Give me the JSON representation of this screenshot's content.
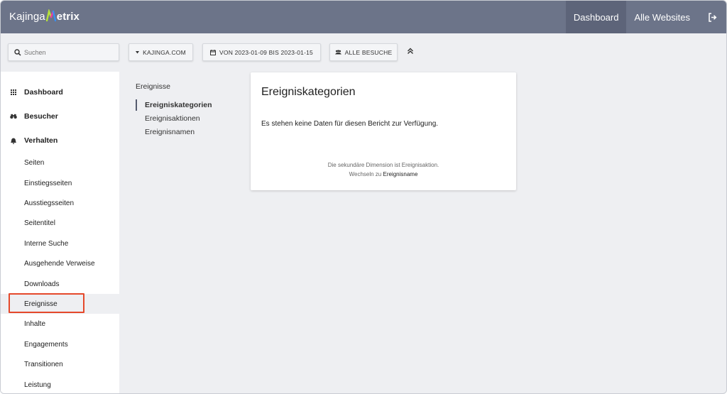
{
  "header": {
    "logo_left": "Kajinga",
    "logo_right": "etrix",
    "nav": [
      {
        "label": "Dashboard",
        "active": true
      },
      {
        "label": "Alle Websites",
        "active": false
      }
    ],
    "logout_icon": "logout-icon"
  },
  "filters": {
    "search_placeholder": "Suchen",
    "site_label": "KAJINGA.COM",
    "date_label": "VON 2023-01-09 BIS 2023-01-15",
    "segment_label": "ALLE BESUCHE",
    "collapse_icon": "double-chevron-up-icon"
  },
  "sidebar": {
    "sections": [
      {
        "label": "Dashboard",
        "icon": "grid-icon"
      },
      {
        "label": "Besucher",
        "icon": "binoculars-icon"
      },
      {
        "label": "Verhalten",
        "icon": "bell-icon"
      }
    ],
    "items": [
      {
        "label": "Seiten"
      },
      {
        "label": "Einstiegsseiten"
      },
      {
        "label": "Ausstiegsseiten"
      },
      {
        "label": "Seitentitel"
      },
      {
        "label": "Interne Suche"
      },
      {
        "label": "Ausgehende Verweise"
      },
      {
        "label": "Downloads"
      },
      {
        "label": "Ereignisse",
        "selected": true
      },
      {
        "label": "Inhalte"
      },
      {
        "label": "Engagements"
      },
      {
        "label": "Transitionen"
      },
      {
        "label": "Leistung"
      }
    ]
  },
  "subnav": {
    "title": "Ereignisse",
    "items": [
      {
        "label": "Ereigniskategorien",
        "active": true
      },
      {
        "label": "Ereignisaktionen",
        "active": false
      },
      {
        "label": "Ereignisnamen",
        "active": false
      }
    ]
  },
  "report": {
    "title": "Ereigniskategorien",
    "empty_message": "Es stehen keine Daten für diesen Bericht zur Verfügung.",
    "secondary_dimension_text": "Die sekundäre Dimension ist Ereignisaktion.",
    "switch_prefix": "Wechseln zu",
    "switch_link": "Ereignisname"
  },
  "colors": {
    "topbar": "#6c7489",
    "highlight_box": "#e5492b"
  }
}
